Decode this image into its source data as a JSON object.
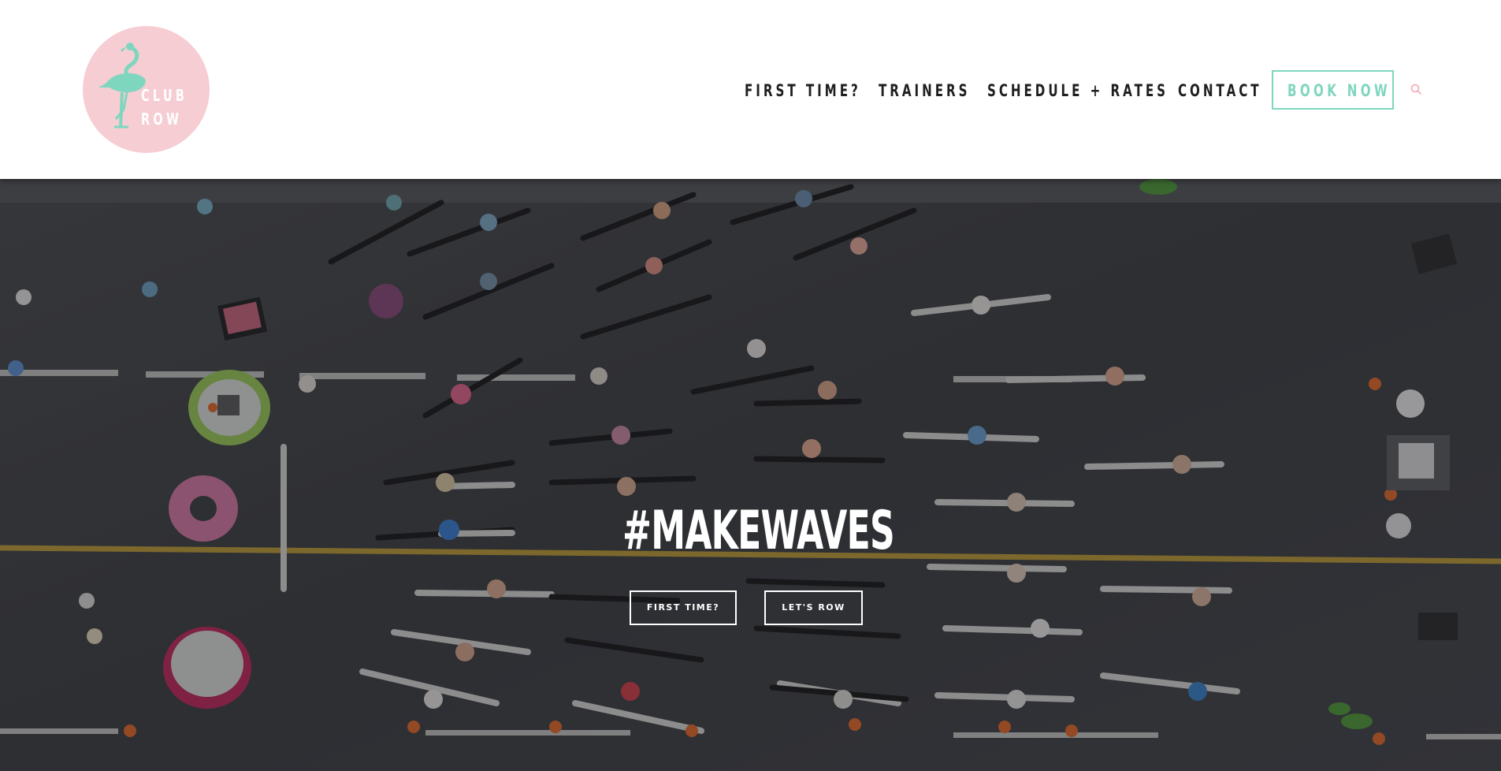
{
  "logo": {
    "line1": "CLUB",
    "line2": "ROW",
    "icon": "flamingo-icon",
    "circle_color": "#f6cdd3",
    "flamingo_color": "#7fd6bf"
  },
  "nav": {
    "items": [
      {
        "label": "FIRST TIME?"
      },
      {
        "label": "TRAINERS"
      },
      {
        "label": "SCHEDULE + RATES"
      },
      {
        "label": "CONTACT"
      }
    ],
    "book_now": "BOOK NOW",
    "search_icon": "search-icon",
    "accent_color": "#7fd6bf"
  },
  "hero": {
    "headline": "#MAKEWAVES",
    "background": "aerial-street-rowing-photo",
    "buttons": [
      {
        "label": "FIRST TIME?"
      },
      {
        "label": "LET'S ROW"
      }
    ]
  }
}
